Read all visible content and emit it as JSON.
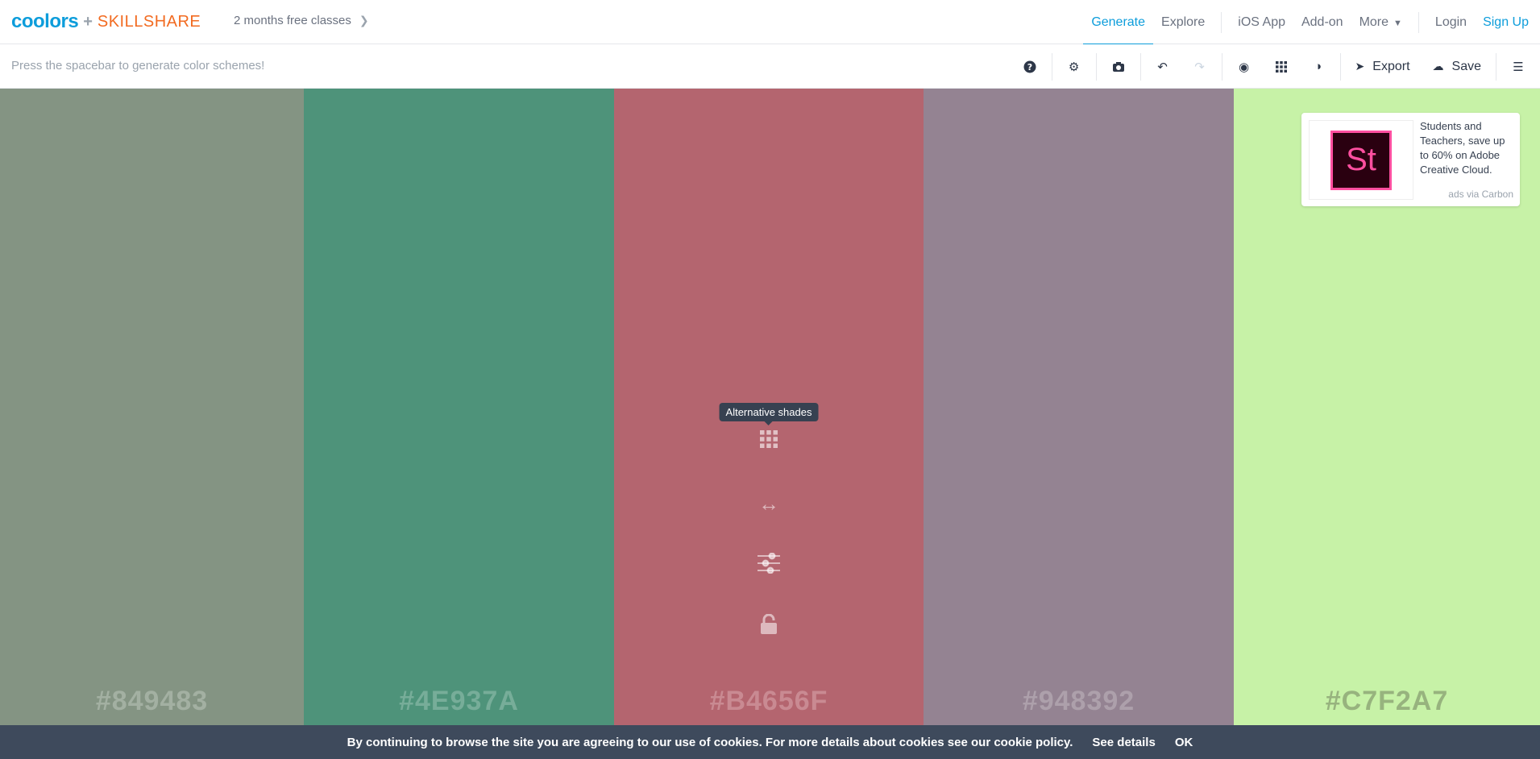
{
  "nav": {
    "brand": "coolors",
    "partner_plus": "+",
    "partner": "SKILLSHARE",
    "promo": "2 months free classes",
    "links": {
      "generate": "Generate",
      "explore": "Explore",
      "ios": "iOS App",
      "addon": "Add-on",
      "more": "More",
      "login": "Login",
      "signup": "Sign Up"
    }
  },
  "toolbar": {
    "hint": "Press the spacebar to generate color schemes!",
    "export": "Export",
    "save": "Save"
  },
  "palette": [
    {
      "hex": "#849483",
      "bg": "#849483",
      "text": "#a3b0a2"
    },
    {
      "hex": "#4E937A",
      "bg": "#4E937A",
      "text": "#77ad99"
    },
    {
      "hex": "#B4656F",
      "bg": "#B4656F",
      "text": "#c98a92"
    },
    {
      "hex": "#948392",
      "bg": "#948392",
      "text": "#ada0ab"
    },
    {
      "hex": "#C7F2A7",
      "bg": "#C7F2A7",
      "text": "#97b37e"
    }
  ],
  "swatch_tools": {
    "tooltip": "Alternative shades",
    "icons": [
      "grid-icon",
      "drag-icon",
      "adjust-icon",
      "lock-icon"
    ]
  },
  "ad": {
    "logo_text": "St",
    "text": "Students and Teachers, save up to 60% on Adobe Creative Cloud.",
    "via": "ads via Carbon"
  },
  "cookie": {
    "message": "By continuing to browse the site you are agreeing to our use of cookies. For more details about cookies see our cookie policy.",
    "details": "See details",
    "ok": "OK"
  }
}
